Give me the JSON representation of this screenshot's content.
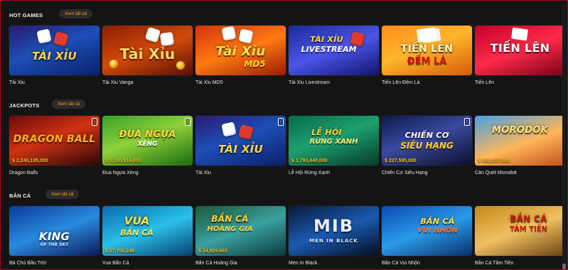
{
  "sections": [
    {
      "title": "HOT GAMES",
      "see_all": "Xem tất cả",
      "games": [
        {
          "name": "Tài Xỉu",
          "logo": "TÀI XỈU",
          "jackpot": null,
          "mobile": false
        },
        {
          "name": "Tài Xỉu Vanga",
          "logo": "Tài Xỉu",
          "jackpot": null,
          "mobile": false
        },
        {
          "name": "Tài Xỉu MD5",
          "logo": "Tài Xỉu",
          "logo_sub": "MD5",
          "jackpot": null,
          "mobile": false
        },
        {
          "name": "Tài Xỉu Livestream",
          "logo": "TÀI XỈU",
          "logo_sub": "LIVESTREAM",
          "jackpot": null,
          "mobile": false
        },
        {
          "name": "Tiến Lên Đếm Lá",
          "logo": "TIẾN LÊN",
          "logo_sub": "ĐẾM LÁ",
          "jackpot": null,
          "mobile": false
        },
        {
          "name": "Tiến Lên",
          "logo": "TIẾN LÊN",
          "jackpot": null,
          "mobile": false
        }
      ]
    },
    {
      "title": "JACKPOTS",
      "see_all": "Xem tất cả",
      "games": [
        {
          "name": "Dragon Balls",
          "logo": "DRAGON BALL",
          "jackpot": "$ 2,240,195,000",
          "mobile": true
        },
        {
          "name": "Đua Ngựa Xèng",
          "logo": "ĐUA NGỰA",
          "logo_sub": "XÈNG",
          "jackpot": "$ 1,130,914,000",
          "mobile": true
        },
        {
          "name": "Tài Xỉu",
          "logo": "TÀI XỈU",
          "jackpot": null,
          "mobile": true
        },
        {
          "name": "Lễ Hội Rừng Xanh",
          "logo": "LỄ HỘI",
          "logo_sub": "RỪNG XANH",
          "jackpot": "$ 1,793,440,000",
          "mobile": false
        },
        {
          "name": "Chiến Cơ Siêu Hạng",
          "logo": "CHIẾN CƠ",
          "logo_sub": "SIÊU HẠNG",
          "jackpot": "$ 227,595,000",
          "mobile": true
        },
        {
          "name": "Càn Quét Morodok",
          "logo": "MORODOK",
          "jackpot": "$ 982,007,500",
          "mobile": false
        }
      ]
    },
    {
      "title": "BẮN CÁ",
      "see_all": "Xem tất cả",
      "games": [
        {
          "name": "Bá Chủ Bầu Trời",
          "logo": "KING",
          "logo_sub": "OF THE SKY",
          "jackpot": null,
          "mobile": false
        },
        {
          "name": "Vua Bắn Cá",
          "logo": "VUA",
          "logo_sub": "BẮN CÁ",
          "jackpot": "$ 27,700,248",
          "mobile": false
        },
        {
          "name": "Bắn Cá Hoàng Gia",
          "logo": "BẮN CÁ",
          "logo_sub": "HOÀNG GIA",
          "jackpot": "$ 34,929,663",
          "mobile": false
        },
        {
          "name": "Men In Black",
          "logo": "MIB",
          "logo_sub": "MEN IN BLACK",
          "jackpot": null,
          "mobile": false
        },
        {
          "name": "Bắn Cá Vui Nhộn",
          "logo": "BẮN CÁ",
          "logo_sub": "VUI NHỘN",
          "jackpot": null,
          "mobile": false
        },
        {
          "name": "Bắn Cá Tâm Tiền",
          "logo": "BẮN CÁ",
          "logo_sub": "TÂM TIỀN",
          "jackpot": null,
          "mobile": false
        }
      ]
    }
  ],
  "colors": {
    "accent": "#f5a623",
    "background": "#141414",
    "jackpot": "#ffc21a",
    "window_border": "#b0001e"
  }
}
